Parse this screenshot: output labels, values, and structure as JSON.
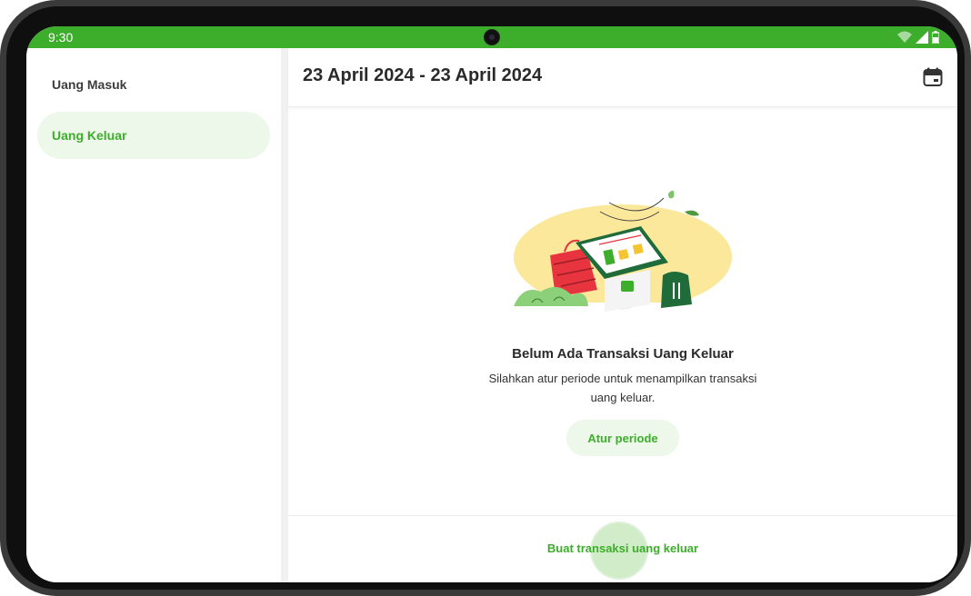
{
  "status_bar": {
    "time": "9:30",
    "color": "#3dae2b"
  },
  "sidebar": {
    "items": [
      {
        "label": "Uang Masuk",
        "active": false
      },
      {
        "label": "Uang Keluar",
        "active": true
      }
    ]
  },
  "header": {
    "title": "23 April 2024 - 23 April 2024",
    "calendar_icon": "calendar-icon"
  },
  "empty_state": {
    "title": "Belum Ada Transaksi Uang Keluar",
    "description": "Silahkan atur periode untuk menampilkan transaksi uang keluar.",
    "button_label": "Atur periode"
  },
  "footer": {
    "button_label": "Buat transaksi uang keluar"
  },
  "colors": {
    "accent": "#3dae2b",
    "accent_light": "#edf7ea"
  }
}
